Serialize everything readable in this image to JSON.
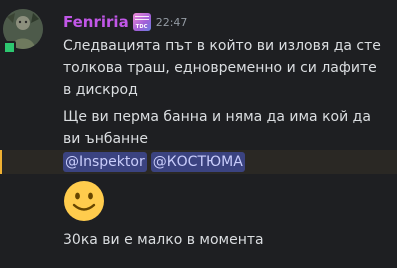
{
  "message": {
    "username": "Fenriria",
    "role_icon": {
      "text": "TDC",
      "icon": "role-badge-icon"
    },
    "timestamp": "22:47",
    "lines": [
      "Следвацията път в който ви изловя да сте",
      "толкова траш, едновременно и си лафите",
      "в дискрод",
      "Ще ви перма банна и няма да има кой да",
      "ви ънбанне"
    ],
    "mentions": [
      "@Inspektor",
      "@КОСТЮМА"
    ],
    "emoji": "slightly-smiling-face-emoji",
    "followup": "30ка ви е малко в момента"
  },
  "colors": {
    "background": "#1e1f22",
    "username": "#c157e8",
    "text": "#dbdee1",
    "timestamp": "#949ba4",
    "mention_bg": "#3b4380",
    "mention_text": "#c9cdfb",
    "highlight_bg": "#2a2824",
    "highlight_bar": "#f0b132"
  }
}
